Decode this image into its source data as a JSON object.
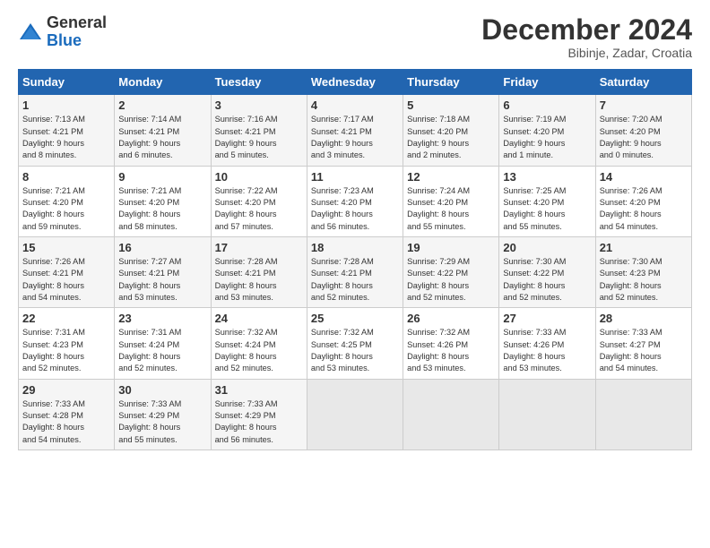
{
  "header": {
    "logo_general": "General",
    "logo_blue": "Blue",
    "month_title": "December 2024",
    "subtitle": "Bibinje, Zadar, Croatia"
  },
  "days_of_week": [
    "Sunday",
    "Monday",
    "Tuesday",
    "Wednesday",
    "Thursday",
    "Friday",
    "Saturday"
  ],
  "weeks": [
    [
      {
        "day": "1",
        "info": "Sunrise: 7:13 AM\nSunset: 4:21 PM\nDaylight: 9 hours\nand 8 minutes."
      },
      {
        "day": "2",
        "info": "Sunrise: 7:14 AM\nSunset: 4:21 PM\nDaylight: 9 hours\nand 6 minutes."
      },
      {
        "day": "3",
        "info": "Sunrise: 7:16 AM\nSunset: 4:21 PM\nDaylight: 9 hours\nand 5 minutes."
      },
      {
        "day": "4",
        "info": "Sunrise: 7:17 AM\nSunset: 4:21 PM\nDaylight: 9 hours\nand 3 minutes."
      },
      {
        "day": "5",
        "info": "Sunrise: 7:18 AM\nSunset: 4:20 PM\nDaylight: 9 hours\nand 2 minutes."
      },
      {
        "day": "6",
        "info": "Sunrise: 7:19 AM\nSunset: 4:20 PM\nDaylight: 9 hours\nand 1 minute."
      },
      {
        "day": "7",
        "info": "Sunrise: 7:20 AM\nSunset: 4:20 PM\nDaylight: 9 hours\nand 0 minutes."
      }
    ],
    [
      {
        "day": "8",
        "info": "Sunrise: 7:21 AM\nSunset: 4:20 PM\nDaylight: 8 hours\nand 59 minutes."
      },
      {
        "day": "9",
        "info": "Sunrise: 7:21 AM\nSunset: 4:20 PM\nDaylight: 8 hours\nand 58 minutes."
      },
      {
        "day": "10",
        "info": "Sunrise: 7:22 AM\nSunset: 4:20 PM\nDaylight: 8 hours\nand 57 minutes."
      },
      {
        "day": "11",
        "info": "Sunrise: 7:23 AM\nSunset: 4:20 PM\nDaylight: 8 hours\nand 56 minutes."
      },
      {
        "day": "12",
        "info": "Sunrise: 7:24 AM\nSunset: 4:20 PM\nDaylight: 8 hours\nand 55 minutes."
      },
      {
        "day": "13",
        "info": "Sunrise: 7:25 AM\nSunset: 4:20 PM\nDaylight: 8 hours\nand 55 minutes."
      },
      {
        "day": "14",
        "info": "Sunrise: 7:26 AM\nSunset: 4:20 PM\nDaylight: 8 hours\nand 54 minutes."
      }
    ],
    [
      {
        "day": "15",
        "info": "Sunrise: 7:26 AM\nSunset: 4:21 PM\nDaylight: 8 hours\nand 54 minutes."
      },
      {
        "day": "16",
        "info": "Sunrise: 7:27 AM\nSunset: 4:21 PM\nDaylight: 8 hours\nand 53 minutes."
      },
      {
        "day": "17",
        "info": "Sunrise: 7:28 AM\nSunset: 4:21 PM\nDaylight: 8 hours\nand 53 minutes."
      },
      {
        "day": "18",
        "info": "Sunrise: 7:28 AM\nSunset: 4:21 PM\nDaylight: 8 hours\nand 52 minutes."
      },
      {
        "day": "19",
        "info": "Sunrise: 7:29 AM\nSunset: 4:22 PM\nDaylight: 8 hours\nand 52 minutes."
      },
      {
        "day": "20",
        "info": "Sunrise: 7:30 AM\nSunset: 4:22 PM\nDaylight: 8 hours\nand 52 minutes."
      },
      {
        "day": "21",
        "info": "Sunrise: 7:30 AM\nSunset: 4:23 PM\nDaylight: 8 hours\nand 52 minutes."
      }
    ],
    [
      {
        "day": "22",
        "info": "Sunrise: 7:31 AM\nSunset: 4:23 PM\nDaylight: 8 hours\nand 52 minutes."
      },
      {
        "day": "23",
        "info": "Sunrise: 7:31 AM\nSunset: 4:24 PM\nDaylight: 8 hours\nand 52 minutes."
      },
      {
        "day": "24",
        "info": "Sunrise: 7:32 AM\nSunset: 4:24 PM\nDaylight: 8 hours\nand 52 minutes."
      },
      {
        "day": "25",
        "info": "Sunrise: 7:32 AM\nSunset: 4:25 PM\nDaylight: 8 hours\nand 53 minutes."
      },
      {
        "day": "26",
        "info": "Sunrise: 7:32 AM\nSunset: 4:26 PM\nDaylight: 8 hours\nand 53 minutes."
      },
      {
        "day": "27",
        "info": "Sunrise: 7:33 AM\nSunset: 4:26 PM\nDaylight: 8 hours\nand 53 minutes."
      },
      {
        "day": "28",
        "info": "Sunrise: 7:33 AM\nSunset: 4:27 PM\nDaylight: 8 hours\nand 54 minutes."
      }
    ],
    [
      {
        "day": "29",
        "info": "Sunrise: 7:33 AM\nSunset: 4:28 PM\nDaylight: 8 hours\nand 54 minutes."
      },
      {
        "day": "30",
        "info": "Sunrise: 7:33 AM\nSunset: 4:29 PM\nDaylight: 8 hours\nand 55 minutes."
      },
      {
        "day": "31",
        "info": "Sunrise: 7:33 AM\nSunset: 4:29 PM\nDaylight: 8 hours\nand 56 minutes."
      },
      {
        "day": "",
        "info": ""
      },
      {
        "day": "",
        "info": ""
      },
      {
        "day": "",
        "info": ""
      },
      {
        "day": "",
        "info": ""
      }
    ]
  ]
}
